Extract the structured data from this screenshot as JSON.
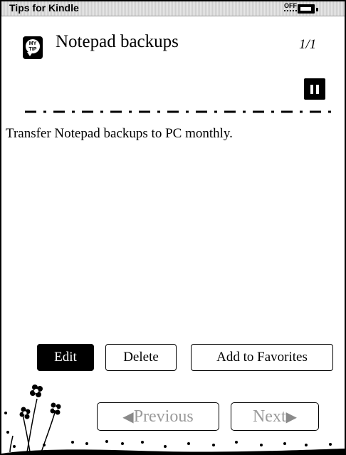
{
  "status_bar": {
    "app_title": "Tips for Kindle",
    "wifi_label": "OFF",
    "battery_icon": "battery-icon"
  },
  "header": {
    "icon": "my-tip-icon",
    "icon_text": [
      "MY",
      "TIP"
    ],
    "title": "Notepad backups",
    "page_count": "1/1",
    "pause_icon": "pause-icon"
  },
  "tip": {
    "text": "Transfer Notepad backups to PC monthly."
  },
  "actions": {
    "edit_label": "Edit",
    "delete_label": "Delete",
    "favorites_label": "Add to Favorites"
  },
  "navigation": {
    "previous_label": "Previous",
    "previous_icon": "arrow-left-icon",
    "next_label": "Next",
    "next_icon": "arrow-right-icon"
  },
  "decoration": {
    "icon": "flowers-icon"
  },
  "colors": {
    "foreground": "#000000",
    "background": "#ffffff",
    "disabled_text": "#9a9a9a",
    "status_bar": "#d9d9d9"
  }
}
